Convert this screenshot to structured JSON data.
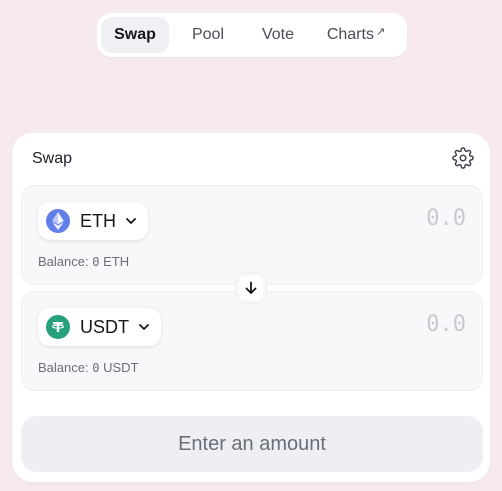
{
  "nav": {
    "tabs": [
      {
        "label": "Swap",
        "active": true
      },
      {
        "label": "Pool",
        "active": false
      },
      {
        "label": "Vote",
        "active": false
      },
      {
        "label": "Charts",
        "active": false,
        "external": true
      }
    ],
    "external_glyph": "↗"
  },
  "swap": {
    "title": "Swap",
    "settings_icon": "gear-icon",
    "from": {
      "token": "ETH",
      "amount_placeholder": "0.0",
      "balance_label": "Balance:",
      "balance_value": "0",
      "balance_unit": "ETH",
      "logo_color": "#627eea"
    },
    "to": {
      "token": "USDT",
      "amount_placeholder": "0.0",
      "balance_label": "Balance:",
      "balance_value": "0",
      "balance_unit": "USDT",
      "logo_color": "#26a17b"
    },
    "submit_label": "Enter an amount"
  },
  "colors": {
    "background": "#f6e9f0",
    "card": "#ffffff",
    "panel": "#f7f8fa",
    "button_disabled": "#edeff3"
  }
}
